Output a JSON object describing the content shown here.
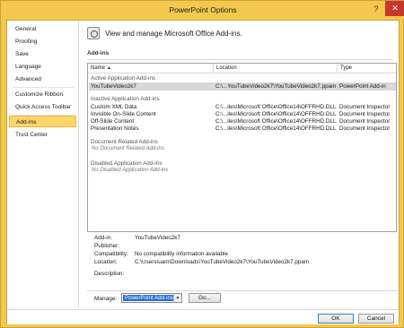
{
  "window": {
    "title": "PowerPoint Options",
    "help": "?",
    "close": "✕"
  },
  "nav": {
    "items": [
      {
        "label": "General"
      },
      {
        "label": "Proofing"
      },
      {
        "label": "Save"
      },
      {
        "label": "Language"
      },
      {
        "label": "Advanced"
      },
      {
        "label": "Customize Ribbon"
      },
      {
        "label": "Quick Access Toolbar"
      },
      {
        "label": "Add-Ins"
      },
      {
        "label": "Trust Center"
      }
    ],
    "active": "Add-Ins"
  },
  "main": {
    "header": "View and manage Microsoft Office Add-ins.",
    "section_title": "Add-ins",
    "columns": {
      "name": "Name",
      "location": "Location",
      "type": "Type"
    },
    "groups": {
      "active": "Active Application Add-ins",
      "inactive": "Inactive Application Add-ins",
      "document": "Document Related Add-ins",
      "disabled": "Disabled Application Add-ins"
    },
    "active_rows": [
      {
        "name": "YouTubeVideo2k7",
        "location": "C:\\...YouTubeVideo2k7\\YouTubeVideo2k7.ppam",
        "type": "PowerPoint Add-in"
      }
    ],
    "inactive_rows": [
      {
        "name": "Custom XML Data",
        "location": "C:\\...iles\\Microsoft Office\\Office14\\OFFRHD.DLL",
        "type": "Document Inspector"
      },
      {
        "name": "Invisible On-Slide Content",
        "location": "C:\\...iles\\Microsoft Office\\Office14\\OFFRHD.DLL",
        "type": "Document Inspector"
      },
      {
        "name": "Off-Slide Content",
        "location": "C:\\...iles\\Microsoft Office\\Office14\\OFFRHD.DLL",
        "type": "Document Inspector"
      },
      {
        "name": "Presentation Notes",
        "location": "C:\\...iles\\Microsoft Office\\Office14\\OFFRHD.DLL",
        "type": "Document Inspector"
      }
    ],
    "document_empty": "No Document Related Add-ins",
    "disabled_empty": "No Disabled Application Add-ins",
    "details": {
      "addin_label": "Add-in:",
      "addin_value": "YouTubeVideo2k7",
      "publisher_label": "Publisher:",
      "publisher_value": "",
      "compat_label": "Compatibility:",
      "compat_value": "No compatibility information available",
      "location_label": "Location:",
      "location_value": "C:\\Users\\uam\\Downloads\\YouTubeVideo2k7\\YouTubeVideo2k7.ppam",
      "description_label": "Description:",
      "description_value": ""
    },
    "manage": {
      "label": "Manage:",
      "selected": "PowerPoint Add-ins",
      "go": "Go..."
    }
  },
  "footer": {
    "ok": "OK",
    "cancel": "Cancel"
  },
  "colors": {
    "frame": "#f2c94c",
    "active_nav": "#fcd66a",
    "selection": "#2a6fd6",
    "close": "#c8372c"
  }
}
